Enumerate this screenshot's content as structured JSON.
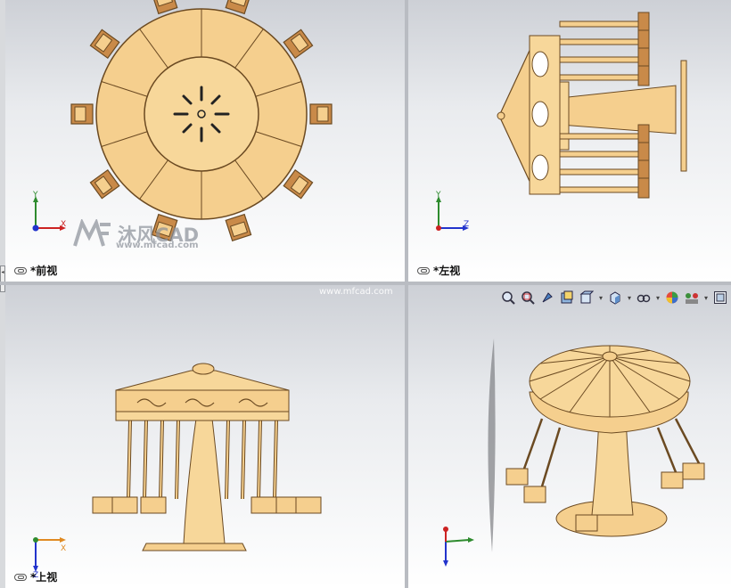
{
  "viewports": {
    "front": {
      "label": "*前视"
    },
    "left": {
      "label": "*左视"
    },
    "top": {
      "label": "*上视"
    },
    "iso": {
      "label": ""
    }
  },
  "axes": {
    "x": "X",
    "y": "Y",
    "z": "Z"
  },
  "watermark": {
    "brand": "沐风CAD",
    "site": "www.mfcad.com",
    "center": "www.mfcad.com"
  },
  "toolbar": {
    "icons": [
      "zoom-to-fit-icon",
      "zoom-area-icon",
      "previous-view-icon",
      "section-view-icon",
      "view-orientation-icon",
      "display-style-icon",
      "hide-show-items-icon",
      "edit-appearance-icon",
      "apply-scene-icon",
      "view-settings-icon"
    ]
  },
  "colors": {
    "model": "#f5cf8e",
    "model_dark": "#6b4a22",
    "bg_top": "#cdd0d6",
    "bg_bottom": "#ffffff"
  }
}
